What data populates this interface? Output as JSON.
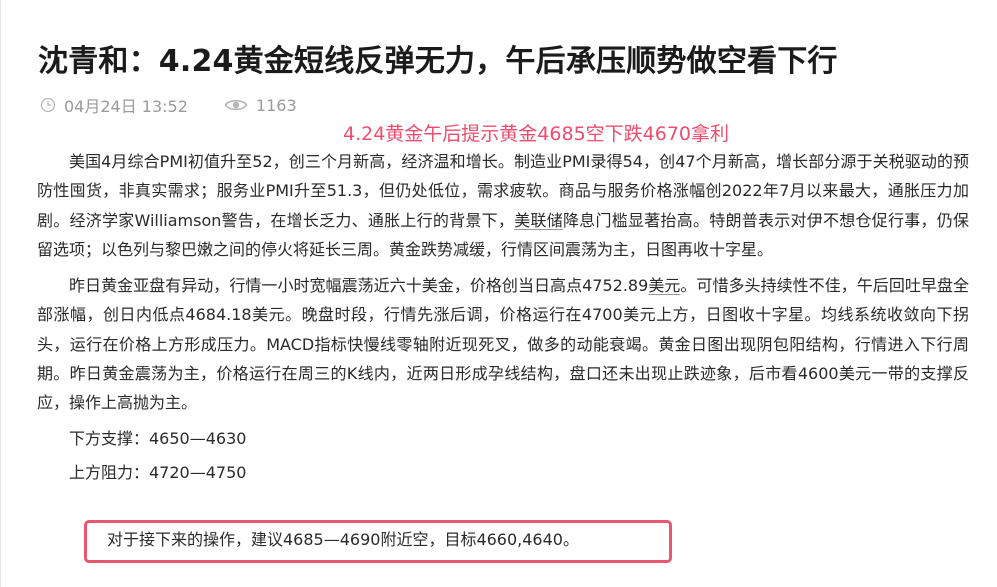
{
  "article": {
    "title": "沈青和：4.24黄金短线反弹无力，午后承压顺势做空看下行",
    "meta": {
      "date": "04月24日 13:52",
      "views": "1163",
      "clock_icon": "clock-icon",
      "eye_icon": "eye-icon"
    },
    "subtitle": "4.24黄金午后提示黄金4685空下跌4670拿利",
    "paragraph1": {
      "before_link": "美国4月综合PMI初值升至52，创三个月新高，经济温和增长。制造业PMI录得54，创47个月新高，增长部分源于关税驱动的预防性囤货，非真实需求；服务业PMI升至51.3，但仍处低位，需求疲软。商品与服务价格涨幅创2022年7月以来最大，通胀压力加剧。经济学家Williamson警告，在增长乏力、通胀上行的背景下，",
      "link": "美联储",
      "after_link": "降息门槛显著抬高。特朗普表示对伊不想仓促行事，仍保留选项；以色列与黎巴嫩之间的停火将延长三周。黄金跌势减缓，行情区间震荡为主，日图再收十字星。"
    },
    "paragraph2": {
      "before_link": "昨日黄金亚盘有异动，行情一小时宽幅震荡近六十美金，价格创当日高点4752.89",
      "link": "美元",
      "after_link": "。可惜多头持续性不佳，午后回吐早盘全部涨幅，创日内低点4684.18美元。晚盘时段，行情先涨后调，价格运行在4700美元上方，日图收十字星。均线系统收敛向下拐头，运行在价格上方形成压力。MACD指标快慢线零轴附近现死叉，做多的动能衰竭。黄金日图出现阴包阳结构，行情进入下行周期。昨日黄金震荡为主，价格运行在周三的K线内，近两日形成孕线结构，盘口还未出现止跌迹象，后市看4600美元一带的支撑反应，操作上高抛为主。"
    },
    "support": "下方支撑：4650—4630",
    "resistance": "上方阻力：4720—4750",
    "operation": "对于接下来的操作，建议4685—4690附近空，目标4660,4640。",
    "colors": {
      "subtitle": "#ee4d6e",
      "highlight_border": "#e9566f",
      "meta": "#9a9a9a"
    }
  }
}
